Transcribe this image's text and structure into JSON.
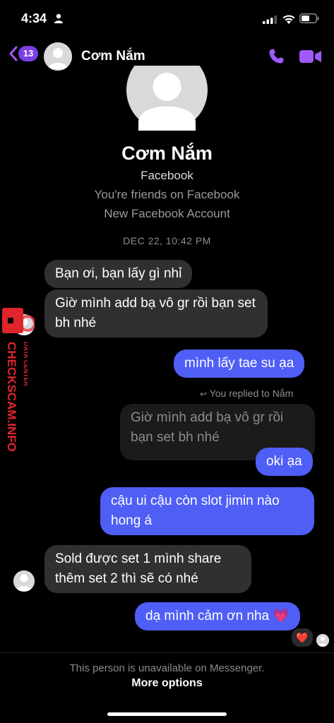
{
  "status_bar": {
    "time": "4:34"
  },
  "header": {
    "back_badge": "13",
    "contact_name": "Cơm Nắm"
  },
  "profile": {
    "name": "Cơm Nắm",
    "source": "Facebook",
    "friends_line": "You're friends on Facebook",
    "account_line": "New Facebook Account"
  },
  "timestamp": "DEC 22, 10:42 PM",
  "messages": [
    {
      "from": "them",
      "text": "Bạn ơi, bạn lấy gì nhỉ"
    },
    {
      "from": "them",
      "text": "Giờ mình add bạ vô gr rồi bạn set bh nhé"
    },
    {
      "from": "me",
      "text": "mình lấy tae su ạa"
    },
    {
      "from": "me",
      "text": "oki ạa",
      "reply_note": "You replied to Nắm",
      "replied_text": "Giờ mình add bạ vô gr rồi bạn set bh nhé"
    },
    {
      "from": "me",
      "text": "cậu ui cậu còn slot jimin nào hong á"
    },
    {
      "from": "them",
      "text": "Sold được set 1 mình share thêm set 2 thì sẽ có nhé"
    },
    {
      "from": "me",
      "text": "dạ mình cảm ơn nha 💗",
      "reaction": "❤️"
    }
  ],
  "footer": {
    "unavailable_text": "This person is unavailable on Messenger.",
    "more_options": "More options"
  },
  "watermark": {
    "brand": "CHECKSCAM.INFO",
    "tagline": "DATA CENTER"
  },
  "colors": {
    "accent": "#a259ff",
    "outgoing_bubble": "#4f5ef5",
    "incoming_bubble": "#303030",
    "watermark_red": "#e0242b"
  }
}
